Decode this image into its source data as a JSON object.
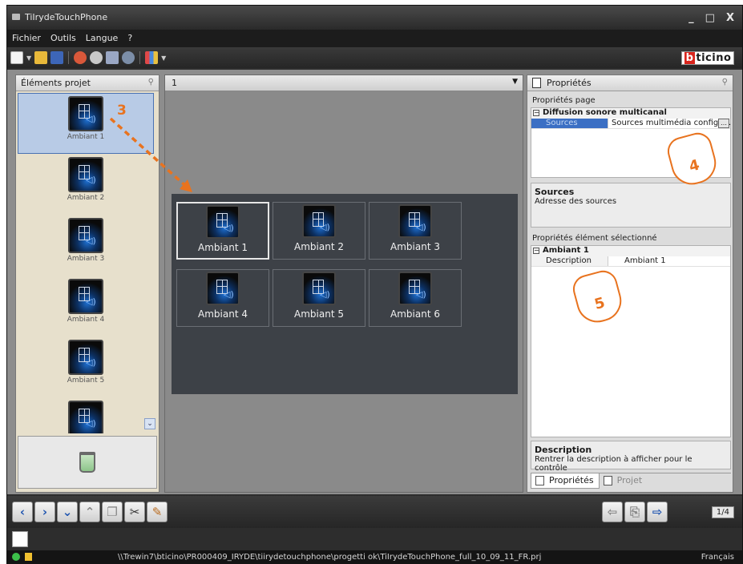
{
  "app": {
    "title": "TiIrydeTouchPhone"
  },
  "window_controls": {
    "minimize": "_",
    "maximize": "□",
    "close": "X"
  },
  "menu": [
    "Fichier",
    "Outils",
    "Langue",
    "?"
  ],
  "brand": {
    "red_part": "b",
    "rest": "ticino"
  },
  "left_panel": {
    "title": "Éléments projet",
    "items": [
      {
        "label": "Ambiant 1",
        "selected": true
      },
      {
        "label": "Ambiant 2"
      },
      {
        "label": "Ambiant 3"
      },
      {
        "label": "Ambiant 4"
      },
      {
        "label": "Ambiant 5"
      },
      {
        "label": ""
      }
    ]
  },
  "center": {
    "page_selector": "1",
    "scenes": [
      "Ambiant 1",
      "Ambiant 2",
      "Ambiant 3",
      "Ambiant 4",
      "Ambiant 5",
      "Ambiant 6"
    ]
  },
  "right_panel": {
    "title": "Propriétés",
    "page_props_label": "Propriétés page",
    "page_category": "Diffusion sonore multicanal",
    "page_row": {
      "name": "Sources",
      "value": "Sources multimédia configur..."
    },
    "sources_info": {
      "title": "Sources",
      "text": "Adresse des sources"
    },
    "element_props_label": "Propriétés élément sélectionné",
    "element_category": "Ambiant 1",
    "element_row": {
      "name": "Description",
      "value": "Ambiant 1"
    },
    "description_info": {
      "title": "Description",
      "text": "Rentrer la description à afficher pour le contrôle"
    },
    "tabs": [
      "Propriétés",
      "Projet"
    ]
  },
  "annotations": {
    "step3": "3",
    "step4": "4",
    "step5": "5"
  },
  "bottom": {
    "page_counter": "1/4"
  },
  "status": {
    "path": "\\\\Trewin7\\bticino\\PR000409_IRYDE\\tiirydetouchphone\\progetti ok\\TiIrydeTouchPhone_full_10_09_11_FR.prj",
    "language": "Français"
  }
}
